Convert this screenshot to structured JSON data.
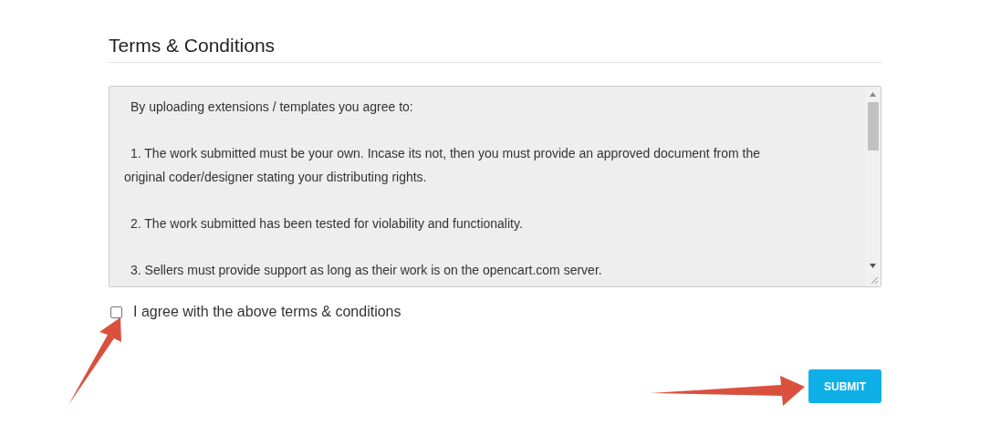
{
  "section": {
    "title": "Terms & Conditions"
  },
  "terms_box": {
    "paragraphs": [
      {
        "lines": [
          "By uploading extensions / templates you agree to:"
        ]
      },
      {
        "lines": [
          "1. The work submitted must be your own. Incase its not, then you must provide an approved document from the",
          "original coder/designer stating your distributing rights."
        ]
      },
      {
        "lines": [
          "2. The work submitted has been tested for violability and functionality."
        ]
      },
      {
        "lines": [
          "3. Sellers must provide support as long as their work is on the opencart.com server."
        ]
      }
    ]
  },
  "agree": {
    "label": "I agree with the above terms & conditions",
    "checked": false
  },
  "submit_button": {
    "label": "SUBMIT"
  }
}
